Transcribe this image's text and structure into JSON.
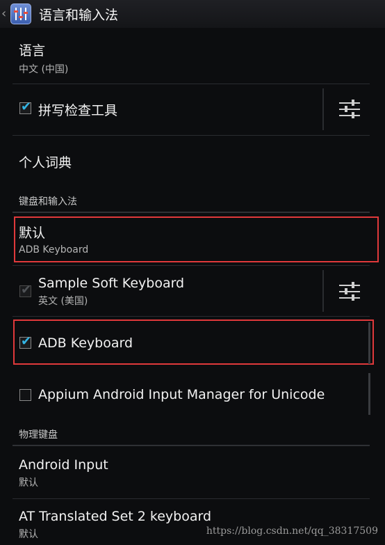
{
  "header": {
    "title": "语言和输入法"
  },
  "settings": {
    "language": {
      "title": "语言",
      "summary": "中文 (中国)"
    },
    "spell_checker": {
      "title": "拼写检查工具",
      "checked": true
    },
    "personal_dictionary": {
      "title": "个人词典"
    }
  },
  "keyboard_section": {
    "header": "键盘和输入法",
    "default": {
      "title": "默认",
      "summary": "ADB Keyboard"
    },
    "methods": [
      {
        "title": "Sample Soft Keyboard",
        "summary": "英文 (美国)",
        "checked": true,
        "enabled": false
      },
      {
        "title": "ADB Keyboard",
        "summary": "",
        "checked": true,
        "enabled": true
      },
      {
        "title": "Appium Android Input Manager for Unicode",
        "summary": "",
        "checked": false,
        "enabled": true
      }
    ]
  },
  "physical_section": {
    "header": "物理键盘",
    "keyboards": [
      {
        "title": "Android Input",
        "summary": "默认"
      },
      {
        "title": "AT Translated Set 2 keyboard",
        "summary": "默认"
      }
    ]
  },
  "watermark": "https://blog.csdn.net/qq_38317509",
  "colors": {
    "accent": "#33b5e5",
    "highlight": "#e0393b",
    "background": "#0c0d0f"
  },
  "icons": {
    "back": "chevron-left-icon",
    "app": "settings-app-icon",
    "input_settings": "sliders-icon"
  }
}
